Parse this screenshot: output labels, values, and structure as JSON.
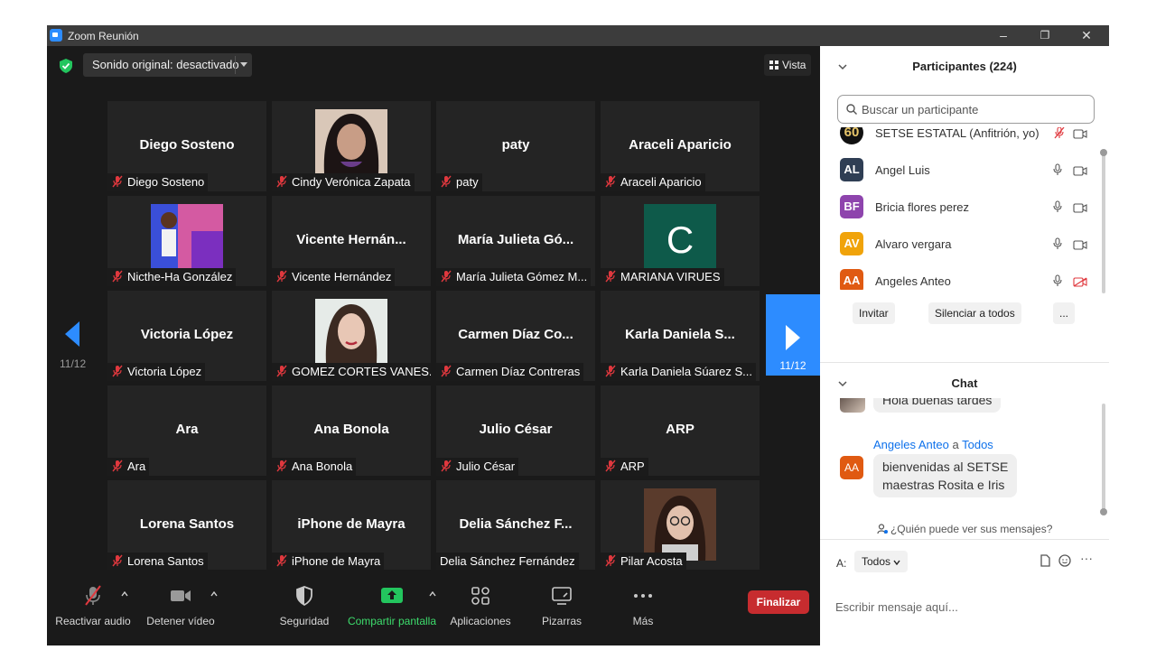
{
  "window": {
    "title": "Zoom Reunión",
    "controls": [
      "–",
      "❐",
      "✕"
    ]
  },
  "stage": {
    "sound_label": "Sonido original: desactivado",
    "view_label": "Vista",
    "page_left": "11/12",
    "page_right": "11/12",
    "tiles": [
      {
        "big": "Diego Sosteno",
        "tag": "Diego Sosteno",
        "muted": true
      },
      {
        "big": "",
        "tag": "Cindy Verónica Zapata",
        "muted": true,
        "media": "photo-woman-dark-hair"
      },
      {
        "big": "paty",
        "tag": "paty",
        "muted": true
      },
      {
        "big": "Araceli Aparicio",
        "tag": "Araceli Aparicio",
        "muted": true
      },
      {
        "big": "",
        "tag": "Nicthe-Ha González",
        "muted": true,
        "media": "photo-maestra-graphic"
      },
      {
        "big": "Vicente  Hernán...",
        "tag": "Vicente Hernández",
        "muted": true
      },
      {
        "big": "María Julieta Gó...",
        "tag": "María Julieta Gómez M...",
        "muted": true
      },
      {
        "big": "",
        "tag": "MARIANA VIRUES",
        "muted": true,
        "media": "letter-avatar",
        "letter": "C"
      },
      {
        "big": "Victoria López",
        "tag": "Victoria López",
        "muted": true
      },
      {
        "big": "",
        "tag": "GOMEZ CORTES VANES...",
        "muted": true,
        "media": "photo-woman-long-hair"
      },
      {
        "big": "Carmen  Díaz  Co...",
        "tag": "Carmen Díaz Contreras",
        "muted": true
      },
      {
        "big": "Karla Daniela  S...",
        "tag": "Karla Daniela  Súarez S...",
        "muted": true
      },
      {
        "big": "Ara",
        "tag": "Ara",
        "muted": true
      },
      {
        "big": "Ana Bonola",
        "tag": "Ana Bonola",
        "muted": true
      },
      {
        "big": "Julio César",
        "tag": "Julio César",
        "muted": true
      },
      {
        "big": "ARP",
        "tag": "ARP",
        "muted": true
      },
      {
        "big": "Lorena Santos",
        "tag": "Lorena Santos",
        "muted": true
      },
      {
        "big": "iPhone de Mayra",
        "tag": "iPhone de Mayra",
        "muted": true
      },
      {
        "big": "Delia  Sánchez  F...",
        "tag": "Delia Sánchez Fernández",
        "muted": false
      },
      {
        "big": "",
        "tag": "Pilar Acosta",
        "muted": true,
        "media": "photo-woman-glasses"
      }
    ]
  },
  "toolbar": {
    "audio": "Reactivar audio",
    "video": "Detener vídeo",
    "security": "Seguridad",
    "share": "Compartir pantalla",
    "apps": "Aplicaciones",
    "whiteboards": "Pizarras",
    "more": "Más",
    "end": "Finalizar"
  },
  "participants": {
    "title": "Participantes (224)",
    "search_placeholder": "Buscar un participante",
    "list": [
      {
        "name": "SETSE ESTATAL (Anfitrión, yo)",
        "initials": "60",
        "color": "#111111",
        "mic": "muted"
      },
      {
        "name": "Angel Luis",
        "initials": "AL",
        "color": "#2f3e54",
        "mic": "on"
      },
      {
        "name": "Bricia flores perez",
        "initials": "BF",
        "color": "#8e44ad",
        "mic": "on"
      },
      {
        "name": "Alvaro vergara",
        "initials": "AV",
        "color": "#f0a30a",
        "mic": "on"
      },
      {
        "name": "Angeles Anteo",
        "initials": "AA",
        "color": "#e05a12",
        "mic": "on"
      }
    ],
    "invite": "Invitar",
    "mute_all": "Silenciar a todos",
    "more": "..."
  },
  "chat": {
    "title": "Chat",
    "prev_message": "Hola buenas tardes",
    "sender": "Angeles Anteo",
    "to_word": "a",
    "recipient": "Todos",
    "sender_initials": "AA",
    "message_line1": "bienvenidas al SETSE",
    "message_line2": "maestras Rosita e Iris",
    "who_can_see": "¿Quién puede ver sus mensajes?",
    "to_label": "A:",
    "to_value": "Todos",
    "input_placeholder": "Escribir mensaje aquí...",
    "more": "···"
  }
}
